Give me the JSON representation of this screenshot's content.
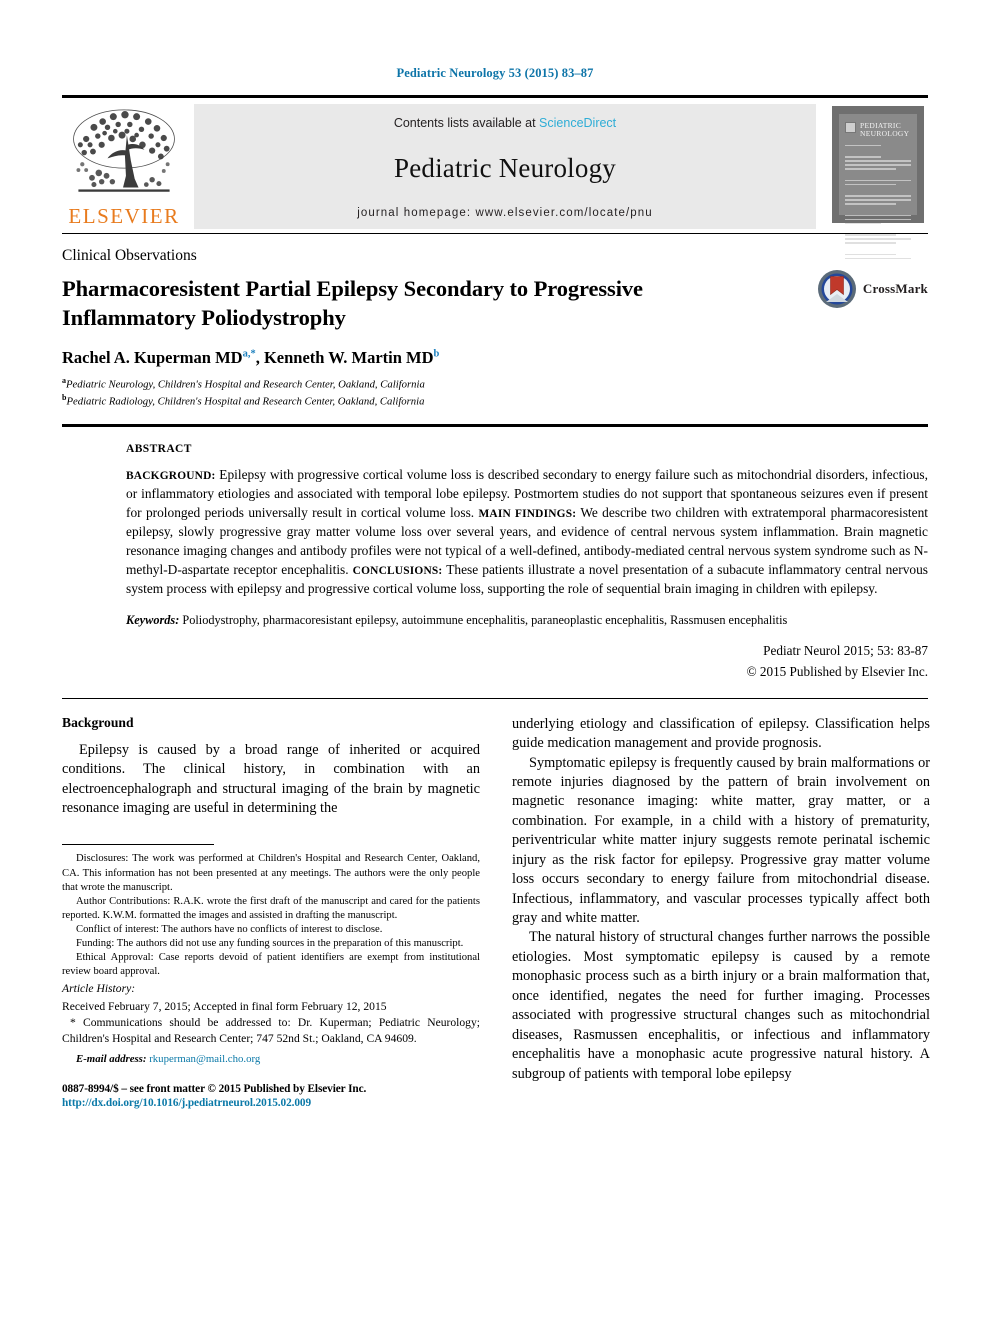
{
  "running_head": "Pediatric Neurology 53 (2015) 83–87",
  "masthead": {
    "publisher_name": "ELSEVIER",
    "contents_prefix": "Contents lists available at ",
    "contents_link": "ScienceDirect",
    "journal_name": "Pediatric Neurology",
    "homepage": "journal homepage: www.elsevier.com/locate/pnu",
    "cover_title_line1": "PEDIATRIC",
    "cover_title_line2": "NEUROLOGY"
  },
  "article": {
    "kicker": "Clinical Observations",
    "title": "Pharmacoresistent Partial Epilepsy Secondary to Progressive Inflammatory Poliodystrophy",
    "authors_plain": "Rachel A. Kuperman MD a,*, Kenneth W. Martin MD b",
    "author1_name": "Rachel A. Kuperman MD",
    "author1_sup": "a,*",
    "author2_name": "Kenneth W. Martin MD",
    "author2_sup": "b",
    "affiliation_a_sup": "a",
    "affiliation_a": "Pediatric Neurology, Children's Hospital and Research Center, Oakland, California",
    "affiliation_b_sup": "b",
    "affiliation_b": "Pediatric Radiology, Children's Hospital and Research Center, Oakland, California",
    "crossmark_label": "CrossMark"
  },
  "abstract": {
    "label": "ABSTRACT",
    "background_label": "BACKGROUND:",
    "background_text": " Epilepsy with progressive cortical volume loss is described secondary to energy failure such as mitochondrial disorders, infectious, or inflammatory etiologies and associated with temporal lobe epilepsy. Postmortem studies do not support that spontaneous seizures even if present for prolonged periods universally result in cortical volume loss. ",
    "main_findings_label": "MAIN FINDINGS:",
    "main_findings_text": " We describe two children with extratemporal pharmacoresistent epilepsy, slowly progressive gray matter volume loss over several years, and evidence of central nervous system inflammation. Brain magnetic resonance imaging changes and antibody profiles were not typical of a well-defined, antibody-mediated central nervous system syndrome such as N-methyl-D-aspartate receptor encephalitis. ",
    "conclusions_label": "CONCLUSIONS:",
    "conclusions_text": " These patients illustrate a novel presentation of a subacute inflammatory central nervous system process with epilepsy and progressive cortical volume loss, supporting the role of sequential brain imaging in children with epilepsy.",
    "keywords_label": "Keywords:",
    "keywords_text": " Poliodystrophy, pharmacoresistant epilepsy, autoimmune encephalitis, paraneoplastic encephalitis, Rassmusen encephalitis",
    "citation": "Pediatr Neurol 2015; 53: 83-87",
    "copyright": "© 2015 Published by Elsevier Inc."
  },
  "body": {
    "heading": "Background",
    "left_paragraph_1": "Epilepsy is caused by a broad range of inherited or acquired conditions. The clinical history, in combination with an electroencephalograph and structural imaging of the brain by magnetic resonance imaging are useful in determining the",
    "right_paragraph_1_cont": "underlying etiology and classification of epilepsy. Classification helps guide medication management and provide prognosis.",
    "right_paragraph_2": "Symptomatic epilepsy is frequently caused by brain malformations or remote injuries diagnosed by the pattern of brain involvement on magnetic resonance imaging: white matter, gray matter, or a combination. For example, in a child with a history of prematurity, periventricular white matter injury suggests remote perinatal ischemic injury as the risk factor for epilepsy. Progressive gray matter volume loss occurs secondary to energy failure from mitochondrial disease. Infectious, inflammatory, and vascular processes typically affect both gray and white matter.",
    "right_paragraph_3": "The natural history of structural changes further narrows the possible etiologies. Most symptomatic epilepsy is caused by a remote monophasic process such as a birth injury or a brain malformation that, once identified, negates the need for further imaging. Processes associated with progressive structural changes such as mitochondrial diseases, Rasmussen encephalitis, or infectious and inflammatory encephalitis have a monophasic acute progressive natural history. A subgroup of patients with temporal lobe epilepsy"
  },
  "footnotes": {
    "disclosures": "Disclosures: The work was performed at Children's Hospital and Research Center, Oakland, CA. This information has not been presented at any meetings. The authors were the only people that wrote the manuscript.",
    "author_contributions": "Author Contributions: R.A.K. wrote the first draft of the manuscript and cared for the patients reported. K.W.M. formatted the images and assisted in drafting the manuscript.",
    "conflict": "Conflict of interest: The authors have no conflicts of interest to disclose.",
    "funding": "Funding: The authors did not use any funding sources in the preparation of this manuscript.",
    "ethical": "Ethical Approval: Case reports devoid of patient identifiers are exempt from institutional review board approval.",
    "article_history_label": "Article History:",
    "article_history_dates": "Received February 7, 2015; Accepted in final form February 12, 2015",
    "correspondence": "* Communications should be addressed to: Dr. Kuperman; Pediatric Neurology; Children's Hospital and Research Center; 747 52nd St.; Oakland, CA 94609.",
    "email_label": "E-mail address:",
    "email": "rkuperman@mail.cho.org",
    "issn_line": "0887-8994/$ – see front matter © 2015 Published by Elsevier Inc.",
    "doi": "http://dx.doi.org/10.1016/j.pediatrneurol.2015.02.009"
  },
  "colors": {
    "running_head": "#0d74a8",
    "sciencedirect_link": "#2eadd6",
    "doi_link": "#0b79a8",
    "elsevier_orange": "#e87b1e",
    "superscript_blue": "#1b7fbd",
    "masthead_grey": "#e9e9e9"
  }
}
